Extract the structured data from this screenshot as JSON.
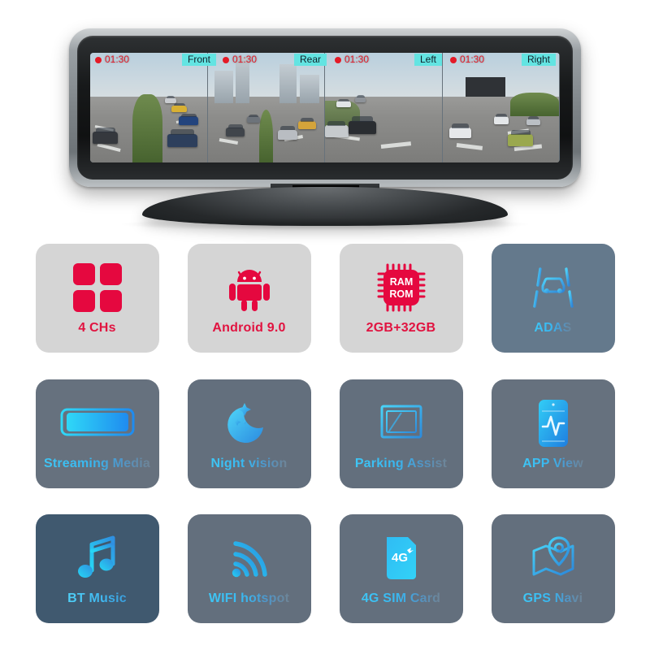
{
  "product": {
    "device_name": "mirror-dashcam",
    "screen": {
      "channels": [
        {
          "label": "Front",
          "rec_time": "01:30",
          "rec_indicator": "record-dot"
        },
        {
          "label": "Rear",
          "rec_time": "01:30",
          "rec_indicator": "record-dot"
        },
        {
          "label": "Left",
          "rec_time": "01:30",
          "rec_indicator": "record-dot"
        },
        {
          "label": "Right",
          "rec_time": "01:30",
          "rec_indicator": "record-dot"
        }
      ],
      "osd_label_bg": "#63e4e2",
      "osd_rec_color": "#e41a27"
    }
  },
  "colors": {
    "accent_red": "#e11340",
    "accent_cyan": "#3ec6f5",
    "tile_light": "#d5d5d5",
    "tile_slate": "#66717e",
    "tile_steel": "#64798c",
    "tile_deep": "#40596f",
    "page_bg": "#ffffff"
  },
  "features": [
    {
      "label": "4 CHs",
      "icon": "four-squares-icon",
      "theme": "light"
    },
    {
      "label": "Android 9.0",
      "icon": "android-robot-icon",
      "theme": "light"
    },
    {
      "label": "2GB+32GB",
      "icon": "chip-ram-rom-icon",
      "theme": "light",
      "icon_text_lines": [
        "RAM",
        "ROM"
      ]
    },
    {
      "label": "ADAS",
      "icon": "car-lane-icon",
      "theme": "steel"
    },
    {
      "label": "Streaming Media",
      "icon": "mirror-screen-icon",
      "theme": "slate"
    },
    {
      "label": "Night vision",
      "icon": "moon-stars-icon",
      "theme": "slate2"
    },
    {
      "label": "Parking Assist",
      "icon": "parking-monitor-icon",
      "theme": "slate2"
    },
    {
      "label": "APP View",
      "icon": "phone-chart-icon",
      "theme": "slate"
    },
    {
      "label": "BT Music",
      "icon": "music-note-icon",
      "theme": "deep"
    },
    {
      "label": "WIFI hotspot",
      "icon": "wifi-icon",
      "theme": "slate2"
    },
    {
      "label": "4G SIM Card",
      "icon": "sim-card-4g-icon",
      "theme": "slate2",
      "icon_text_lines": [
        "4G"
      ]
    },
    {
      "label": "GPS Navi",
      "icon": "map-pin-icon",
      "theme": "slate2"
    }
  ]
}
